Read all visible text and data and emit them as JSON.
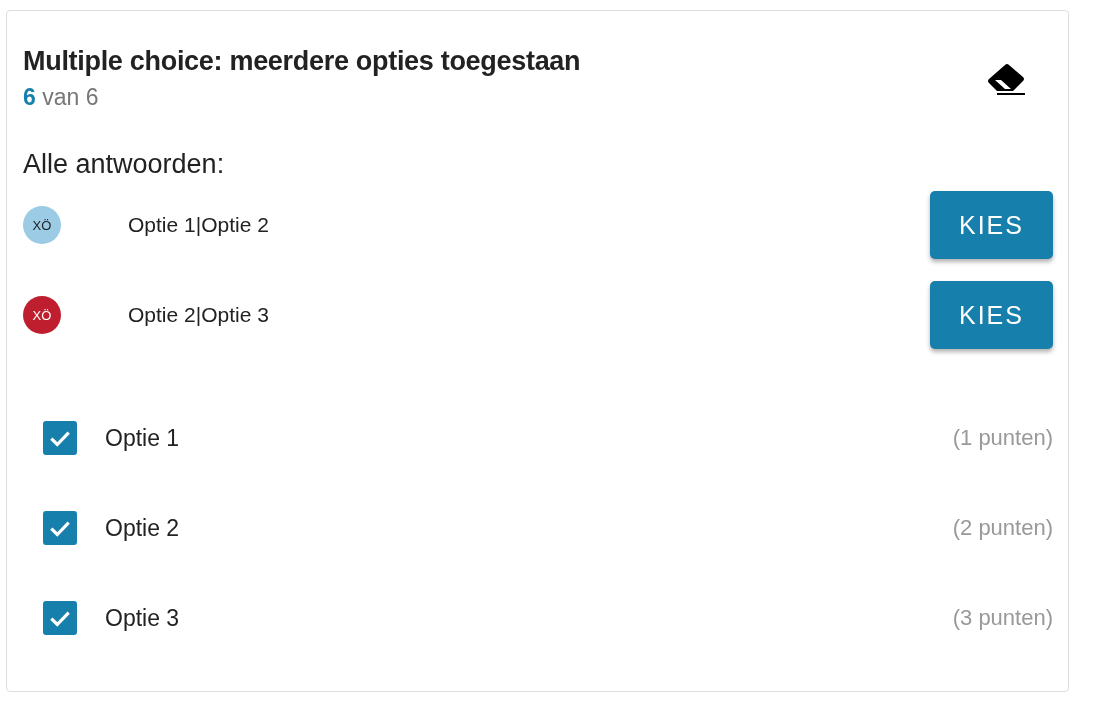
{
  "question": {
    "title": "Multiple choice: meerdere opties toegestaan",
    "score": "6",
    "score_suffix": "van 6"
  },
  "answers_heading": "Alle antwoorden:",
  "answers": [
    {
      "avatar": "XÖ",
      "color": "#9ccbe6",
      "text": "Optie 1|Optie 2",
      "button": "KIES"
    },
    {
      "avatar": "XÖ",
      "color": "#be1e2d",
      "text": "Optie 2|Optie 3",
      "button": "KIES"
    }
  ],
  "options": [
    {
      "label": "Optie 1",
      "points": "(1 punten)",
      "checked": true
    },
    {
      "label": "Optie 2",
      "points": "(2 punten)",
      "checked": true
    },
    {
      "label": "Optie 3",
      "points": "(3 punten)",
      "checked": true
    }
  ]
}
